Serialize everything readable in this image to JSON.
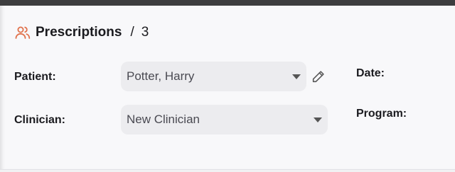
{
  "header": {
    "title": "Prescriptions",
    "separator": "/",
    "count": "3",
    "icon": "users-icon"
  },
  "form": {
    "patient": {
      "label": "Patient:",
      "value": "Potter, Harry"
    },
    "clinician": {
      "label": "Clinician:",
      "value": "New Clinician"
    },
    "date": {
      "label": "Date:"
    },
    "program": {
      "label": "Program:"
    }
  },
  "colors": {
    "accent": "#e0714b",
    "text": "#1b1b1f",
    "field_bg": "#ececef"
  },
  "icons": {
    "edit": "pencil-icon",
    "dropdown": "chevron-down-icon"
  }
}
